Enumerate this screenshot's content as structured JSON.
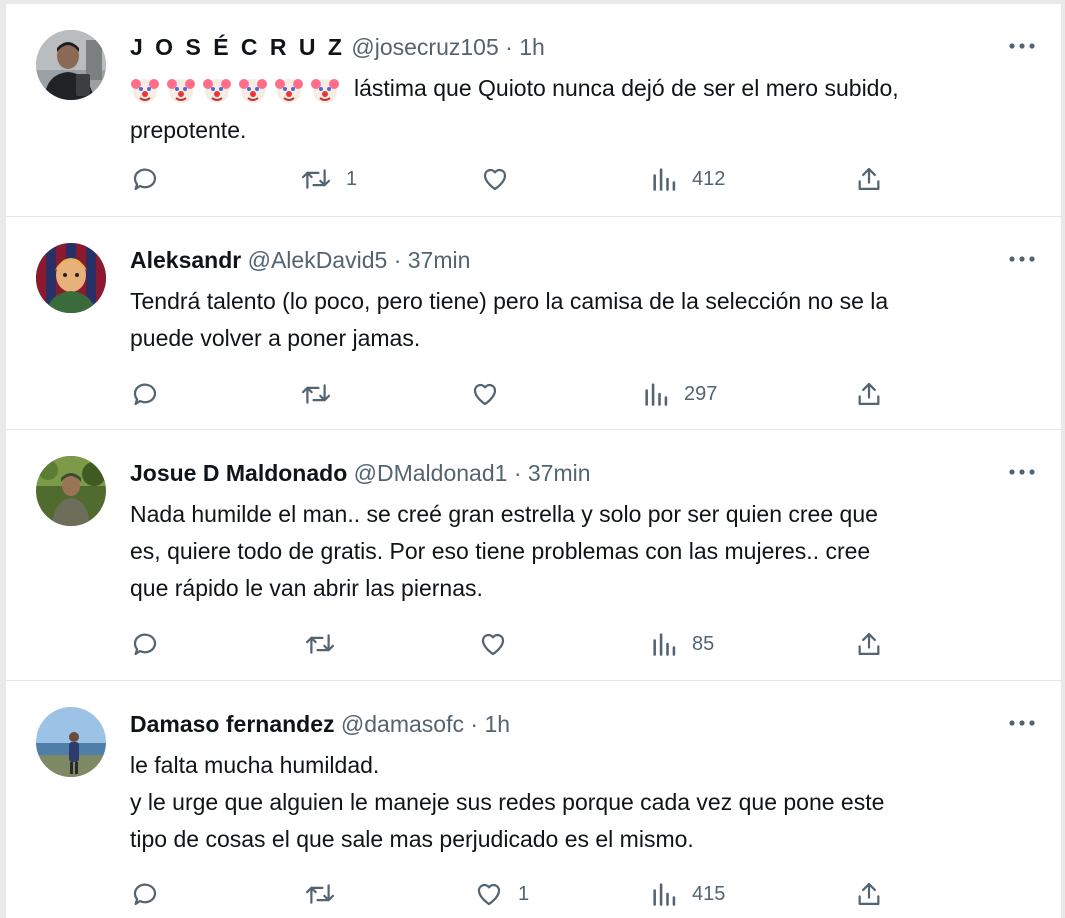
{
  "tweets": [
    {
      "display_name": "J O S É C R U Z",
      "handle": "@josecruz105",
      "time": "1h",
      "emoji_icons": [
        "clown-face",
        "clown-face",
        "clown-face",
        "clown-face",
        "clown-face",
        "clown-face"
      ],
      "text": "lástima que Quioto nunca dejó de ser el mero subido,\nprepotente.",
      "reply_count": "",
      "retweet_count": "1",
      "like_count": "",
      "view_count": "412"
    },
    {
      "display_name": "Aleksandr",
      "handle": "@AlekDavid5",
      "time": "37min",
      "text": "Tendrá talento (lo poco, pero tiene) pero la camisa de la selección no se la\npuede volver a poner jamas.",
      "reply_count": "",
      "retweet_count": "",
      "like_count": "",
      "view_count": "297"
    },
    {
      "display_name": "Josue D Maldonado",
      "handle": "@DMaldonad1",
      "time": "37min",
      "text": "Nada humilde el man.. se creé gran estrella y solo por ser quien cree que\nes, quiere todo de gratis. Por eso tiene problemas con las mujeres.. cree\nque rápido le van abrir las piernas.",
      "reply_count": "",
      "retweet_count": "",
      "like_count": "",
      "view_count": "85"
    },
    {
      "display_name": "Damaso fernandez",
      "handle": "@damasofc",
      "time": "1h",
      "text": "le falta mucha humildad.\ny le urge que alguien le maneje sus redes porque cada vez que pone este\ntipo de cosas el que sale mas perjudicado es el mismo.",
      "reply_count": "",
      "retweet_count": "",
      "like_count": "1",
      "view_count": "415"
    }
  ],
  "separator": "·",
  "icons": {
    "reply": "reply-icon",
    "retweet": "retweet-icon",
    "like": "heart-icon",
    "views": "views-icon",
    "share": "share-icon",
    "more": "more-icon"
  },
  "colors": {
    "text": "#0f1419",
    "secondary": "#536471",
    "divider": "#e6e6e6"
  }
}
